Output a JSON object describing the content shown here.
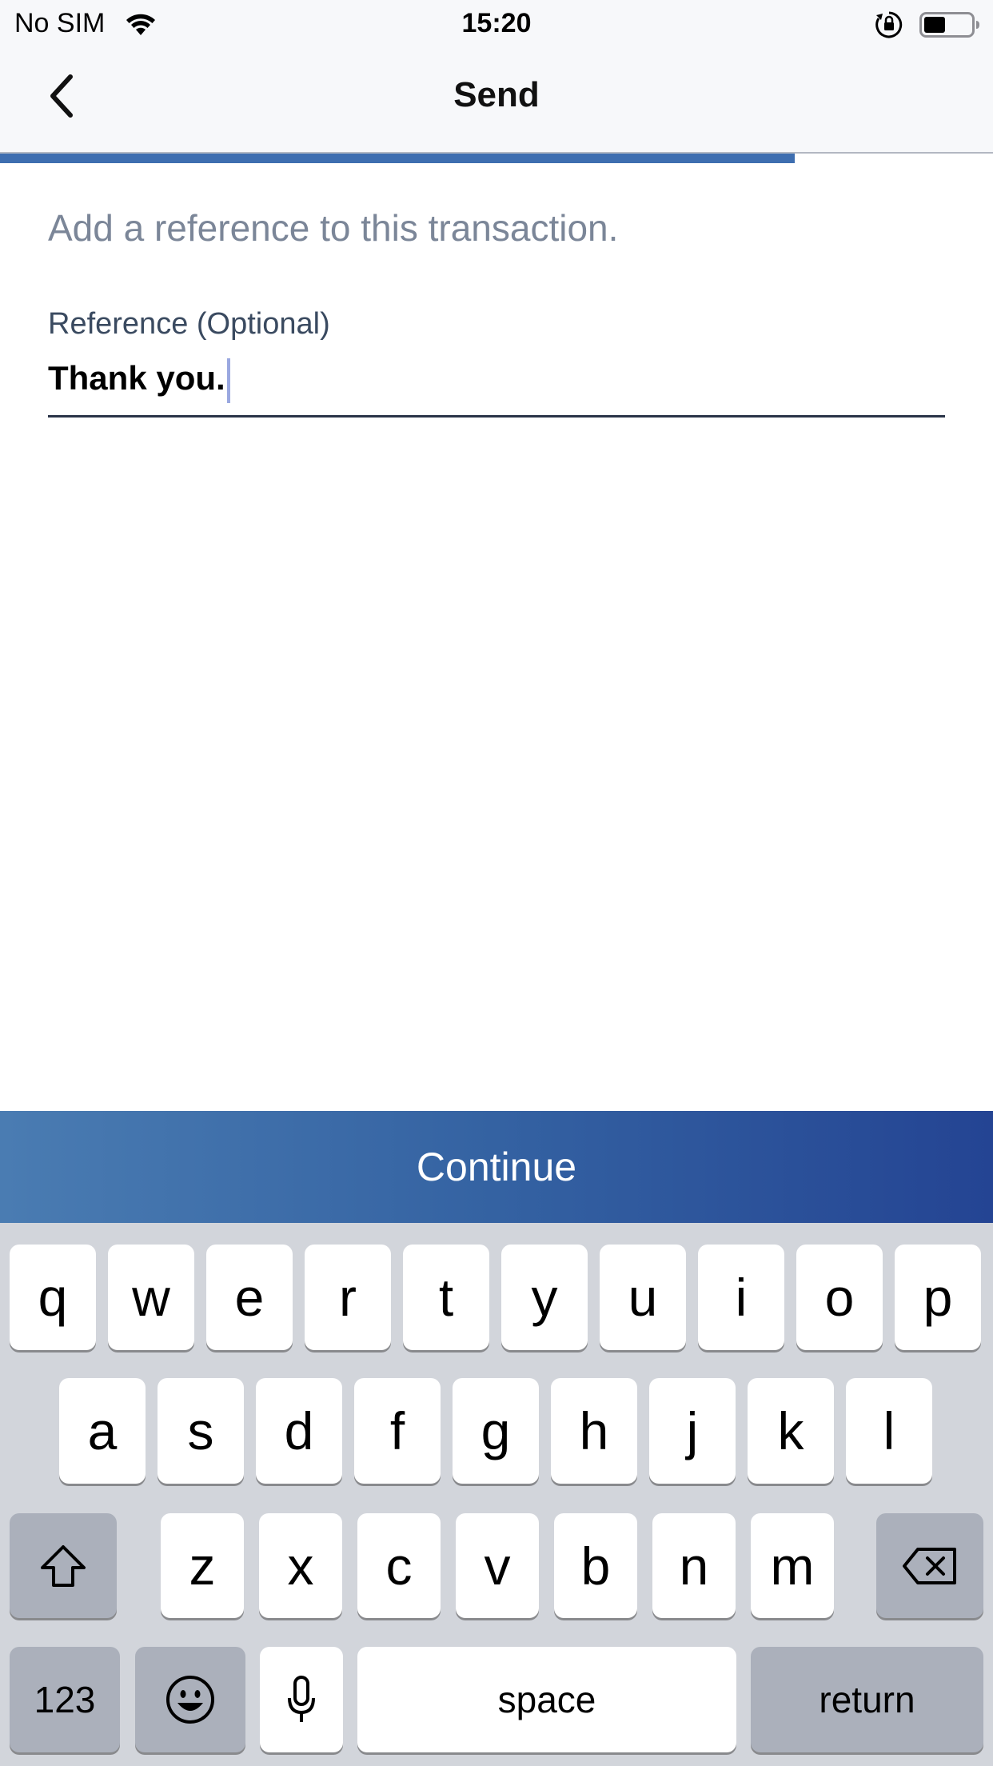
{
  "status_bar": {
    "carrier": "No SIM",
    "time": "15:20",
    "battery_level": 0.45
  },
  "nav": {
    "title": "Send",
    "back_icon": "chevron-left-icon"
  },
  "progress": {
    "value": 0.8
  },
  "form": {
    "instruction": "Add a reference to this transaction.",
    "reference_label": "Reference (Optional)",
    "reference_value": "Thank you."
  },
  "continue_label": "Continue",
  "keyboard": {
    "row1": [
      "q",
      "w",
      "e",
      "r",
      "t",
      "y",
      "u",
      "i",
      "o",
      "p"
    ],
    "row2": [
      "a",
      "s",
      "d",
      "f",
      "g",
      "h",
      "j",
      "k",
      "l"
    ],
    "row3": [
      "z",
      "x",
      "c",
      "v",
      "b",
      "n",
      "m"
    ],
    "numbers_label": "123",
    "space_label": "space",
    "return_label": "return"
  },
  "colors": {
    "accent": "#3e6eb0",
    "continue_start": "#4a7cb2",
    "continue_end": "#244493",
    "keyboard_bg": "#d2d5db"
  }
}
